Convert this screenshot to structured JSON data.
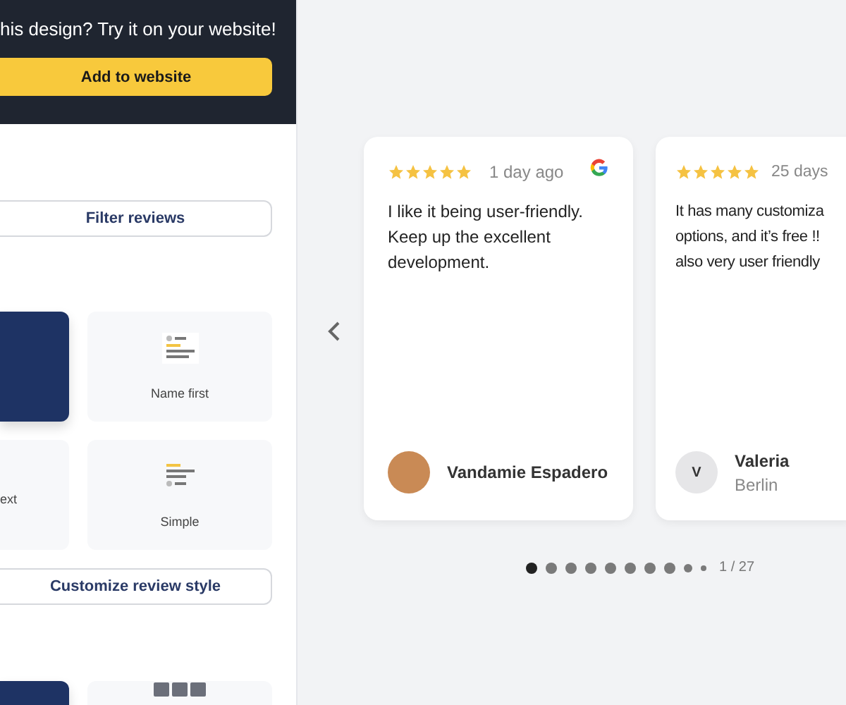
{
  "promo": {
    "text": "his design? Try it on your website!",
    "button": "Add to website"
  },
  "filter_button": "Filter reviews",
  "styles": [
    {
      "selected": true,
      "kind": "blank"
    },
    {
      "label": "Name first",
      "selected": false,
      "kind": "name-first"
    },
    {
      "label": "ext",
      "selected": false,
      "kind": "blank"
    },
    {
      "label": "Simple",
      "selected": false,
      "kind": "simple"
    }
  ],
  "customize_button": "Customize review style",
  "layouts": [
    {
      "selected": true,
      "kind": "blank"
    },
    {
      "selected": false,
      "kind": "grid"
    }
  ],
  "reviews": [
    {
      "stars": 5,
      "time": "1 day ago",
      "google_badge": true,
      "lines": [
        "I like it being user-friendly.",
        "Keep up the excellent",
        "development."
      ],
      "name": "Vandamie Espadero",
      "avatar": {
        "kind": "photo"
      }
    },
    {
      "stars": 5,
      "time": "25 days",
      "google_badge": false,
      "lines": [
        "It has many customiza",
        "options, and it’s free !!",
        "also very user friendly"
      ],
      "name": "Valeria",
      "location": "Berlin",
      "avatar": {
        "kind": "initial",
        "letter": "V"
      }
    }
  ],
  "pager": {
    "dots": [
      {
        "selected": true,
        "kind": "large"
      },
      {
        "selected": false,
        "kind": "large"
      },
      {
        "selected": false,
        "kind": "large"
      },
      {
        "selected": false,
        "kind": "large"
      },
      {
        "selected": false,
        "kind": "large"
      },
      {
        "selected": false,
        "kind": "large"
      },
      {
        "selected": false,
        "kind": "large"
      },
      {
        "selected": false,
        "kind": "large"
      },
      {
        "selected": false,
        "kind": "medium"
      },
      {
        "selected": false,
        "kind": "small"
      }
    ],
    "count": "1 / 27"
  }
}
